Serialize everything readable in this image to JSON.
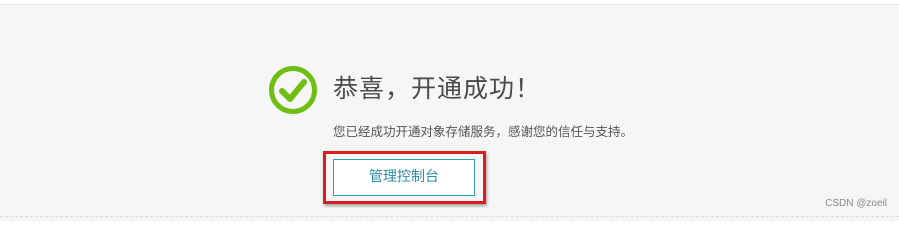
{
  "success": {
    "icon": "check-circle-icon",
    "title": "恭喜，开通成功！",
    "message": "您已经成功开通对象存储服务，感谢您的信任与支持。",
    "icon_color": "#6fbe12"
  },
  "actions": {
    "console_label": "管理控制台",
    "button_color": "#2ea0b4",
    "highlight_color": "#d81e1e"
  },
  "watermark": {
    "text": "CSDN @zoeil"
  }
}
